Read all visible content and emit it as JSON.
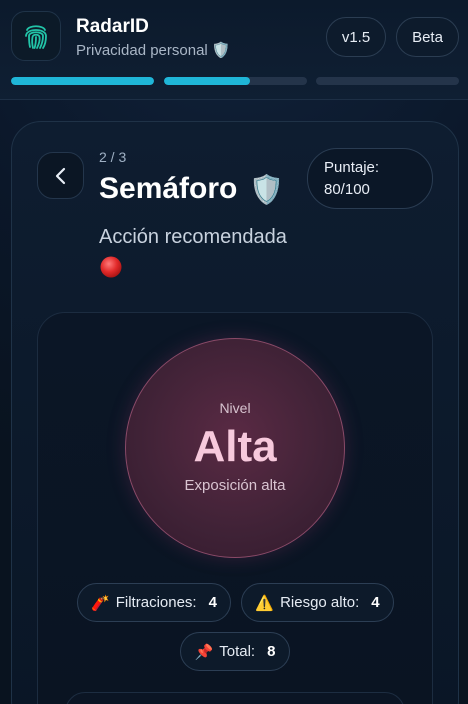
{
  "header": {
    "app_name": "RadarID",
    "subtitle": "Privacidad personal 🛡️",
    "version": "v1.5",
    "beta": "Beta",
    "progress": [
      1.0,
      0.6,
      0.0
    ],
    "accent": "#1fb6d8"
  },
  "card": {
    "step": "2 / 3",
    "title": "Semáforo",
    "title_icon": "🛡️",
    "score_label": "Puntaje:",
    "score_value": "80/100",
    "action_label": "Acción recomendada",
    "status_icon": "red-circle"
  },
  "level": {
    "label": "Nivel",
    "value": "Alta",
    "description": "Exposición alta",
    "color": "#f7c9dc"
  },
  "chips": [
    {
      "icon": "🧨",
      "label": "Filtraciones:",
      "count": "4"
    },
    {
      "icon": "⚠️",
      "label": "Riesgo alto:",
      "count": "4"
    },
    {
      "icon": "📌",
      "label": "Total:",
      "count": "8"
    }
  ]
}
